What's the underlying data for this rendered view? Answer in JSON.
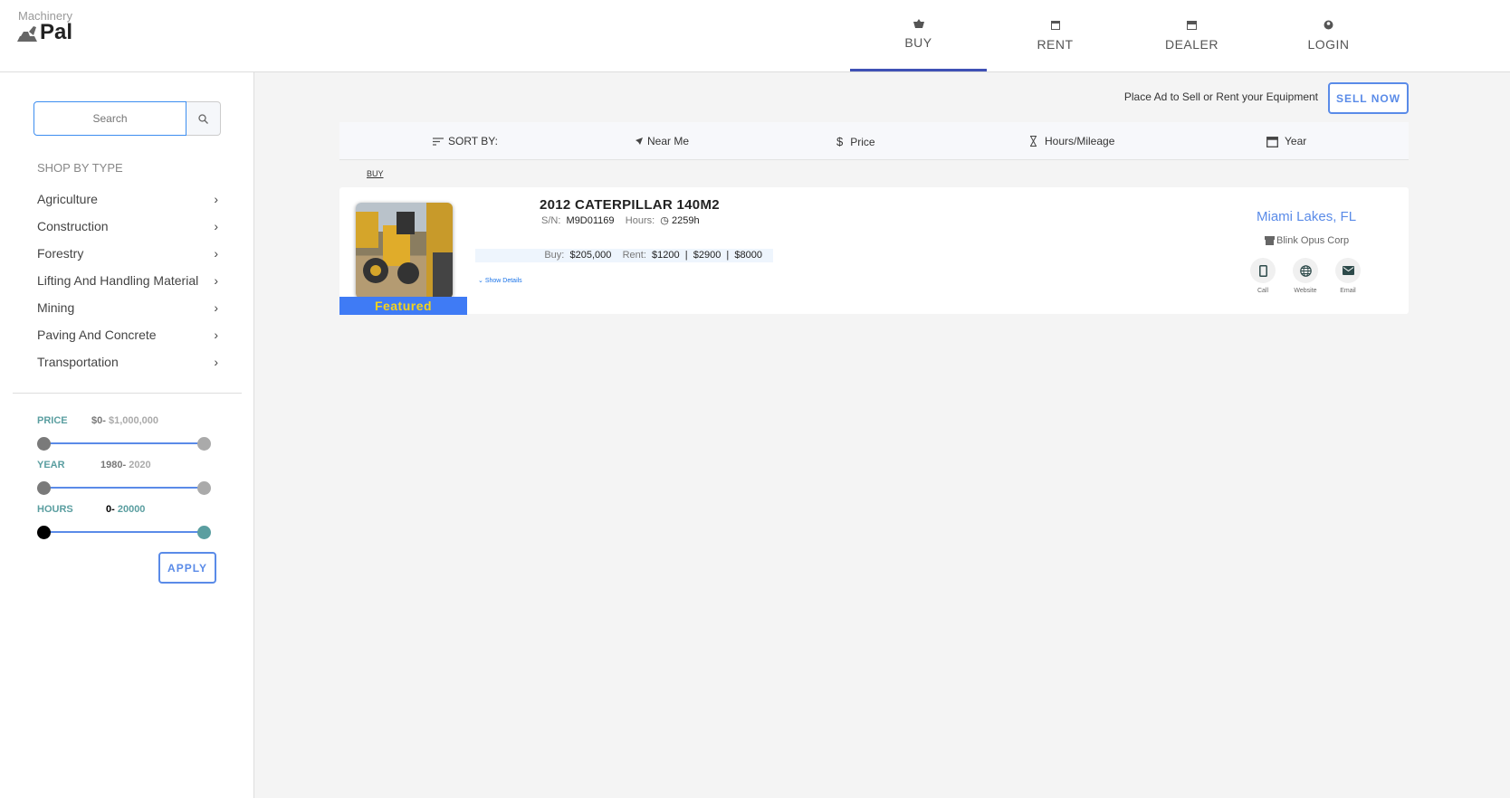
{
  "logo": {
    "top": "Machinery",
    "main": "Pal"
  },
  "nav": [
    {
      "label": "BUY",
      "icon": "basket-icon"
    },
    {
      "label": "RENT",
      "icon": "calendar-icon"
    },
    {
      "label": "DEALER",
      "icon": "store-icon"
    },
    {
      "label": "LOGIN",
      "icon": "account-icon"
    }
  ],
  "sidebar": {
    "search_placeholder": "Search",
    "shop_by_type": "SHOP BY TYPE",
    "types": [
      "Agriculture",
      "Construction",
      "Forestry",
      "Lifting And Handling Material",
      "Mining",
      "Paving And Concrete",
      "Transportation"
    ],
    "filters": {
      "price": {
        "label": "PRICE",
        "min": "$0-",
        "max": " $1,000,000"
      },
      "year": {
        "label": "YEAR",
        "min": "1980-",
        "max": " 2020"
      },
      "hours": {
        "label": "HOURS",
        "min": "0-",
        "max": " 20000"
      }
    },
    "apply": "APPLY"
  },
  "main": {
    "place_ad": "Place Ad to Sell or Rent your Equipment",
    "sell_now": "SELL NOW",
    "sort": {
      "label": "SORT BY:",
      "near": "Near Me",
      "price": "Price",
      "hours": "Hours/Mileage",
      "year": "Year"
    },
    "breadcrumb": "BUY",
    "listing": {
      "title": "2012 CATERPILLAR 140M2",
      "sn_label": "S/N:",
      "sn": "M9D01169",
      "hours_label": "Hours:",
      "hours": "2259h",
      "buy_label": "Buy:",
      "buy": "$205,000",
      "rent_label": "Rent:",
      "rent1": "$1200",
      "rent2": "$2900",
      "rent3": "$8000",
      "show_details": "Show Details",
      "featured": "Featured",
      "location": "Miami Lakes, FL",
      "dealer": "Blink Opus Corp",
      "actions": {
        "call": "Call",
        "website": "Website",
        "email": "Email"
      }
    }
  },
  "colors": {
    "accent": "#5a8be8",
    "tab_active": "#3f51b5",
    "featured_bg": "#3f7bf5",
    "featured_text": "#f5d31c",
    "filter_label": "#5a9ea0"
  }
}
